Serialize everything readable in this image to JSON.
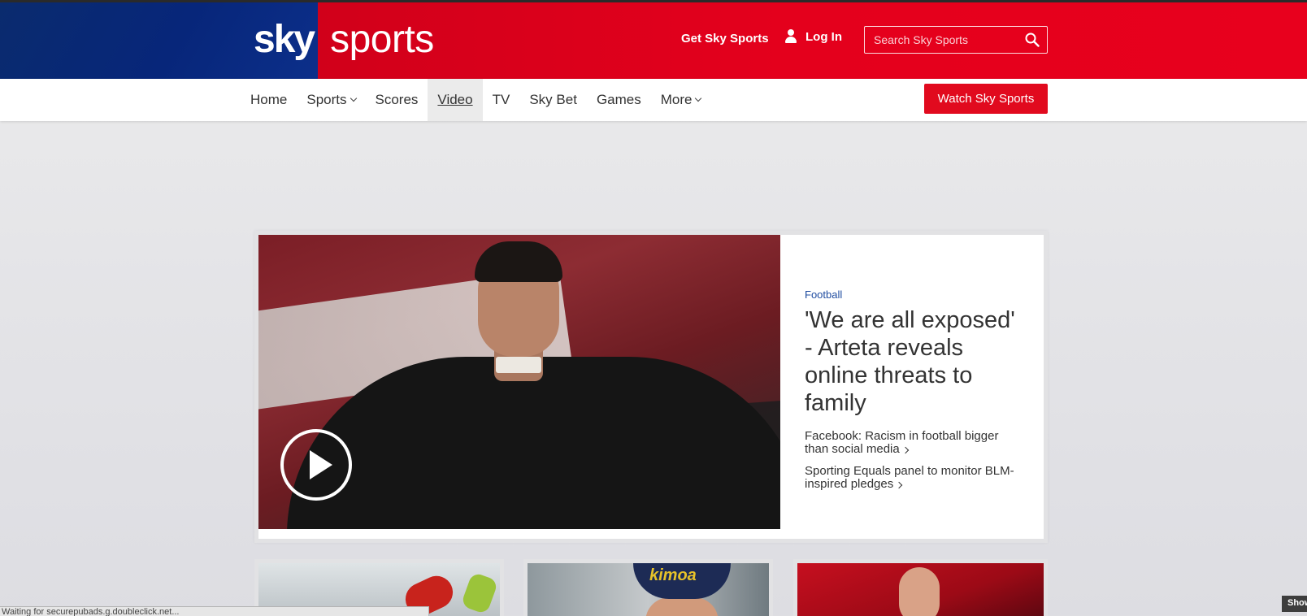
{
  "header": {
    "logo_sky": "sky",
    "logo_sports": "sports",
    "get_sky_sports": "Get Sky Sports",
    "login_label": "Log In",
    "search_placeholder": "Search Sky Sports"
  },
  "nav": {
    "items": [
      {
        "label": "Home"
      },
      {
        "label": "Sports",
        "dropdown": true
      },
      {
        "label": "Scores"
      },
      {
        "label": "Video",
        "active": true
      },
      {
        "label": "TV"
      },
      {
        "label": "Sky Bet"
      },
      {
        "label": "Games"
      },
      {
        "label": "More",
        "dropdown": true
      }
    ],
    "watch_button": "Watch Sky Sports"
  },
  "hero": {
    "category": "Football",
    "headline": "'We are all exposed' - Arteta reveals online threats to family",
    "related": [
      {
        "text": "Facebook: Racism in football bigger than social media"
      },
      {
        "text": "Sporting Equals panel to monitor BLM-inspired pledges"
      }
    ]
  },
  "cards": [
    {
      "image": "goalkeeper-photo"
    },
    {
      "image": "driver-cap-photo",
      "cap_text": "kimoa"
    },
    {
      "image": "boxer-photo"
    }
  ],
  "status_bar": {
    "text": "Waiting for securepubads.g.doubleclick.net..."
  },
  "show_tab": "Show",
  "colors": {
    "header_red": "#e4001c",
    "logo_blue": "#07267a",
    "accent_red": "#e10a1e",
    "category_blue": "#1f4ca0"
  }
}
